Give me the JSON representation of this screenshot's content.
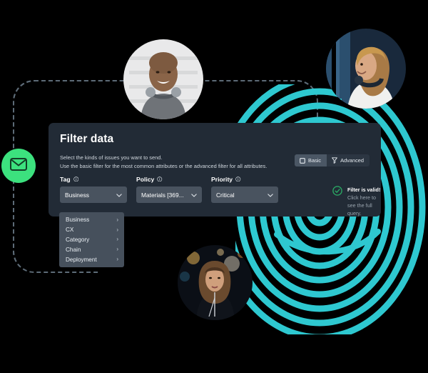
{
  "card": {
    "title": "Filter data",
    "description_line1": "Select the kinds of issues you want to send.",
    "description_line2": "Use the basic filter for the most common attributes or the advanced filter for all attributes.",
    "mode_toggle": [
      {
        "label": "Basic",
        "icon": "checkbox-square-icon",
        "active": true
      },
      {
        "label": "Advanced",
        "icon": "filter-funnel-icon",
        "active": false
      }
    ],
    "fields": [
      {
        "label": "Tag",
        "info_icon": "info-circle-icon",
        "value": "Business",
        "chevron": "chevron-down-icon"
      },
      {
        "label": "Policy",
        "info_icon": "info-circle-icon",
        "value": "Materials [369...",
        "chevron": "chevron-down-icon"
      },
      {
        "label": "Priority",
        "info_icon": "info-circle-icon",
        "value": "Critical",
        "chevron": "chevron-down-icon"
      }
    ],
    "validity": {
      "icon": "check-circle-icon",
      "strong_text": "Filter is valid!",
      "rest_text": " Click here to see the full query.",
      "accent_color": "#2aa763"
    }
  },
  "dropdown": {
    "items": [
      {
        "label": "Business",
        "chevron": "›"
      },
      {
        "label": "CX",
        "chevron": "›"
      },
      {
        "label": "Category",
        "chevron": "›"
      },
      {
        "label": "Chain",
        "chevron": "›"
      },
      {
        "label": "Deployment",
        "chevron": "›"
      }
    ]
  },
  "decorations": {
    "mail_badge": {
      "icon": "envelope-icon",
      "background": "#3ce17e",
      "glyph_color": "#123d26"
    },
    "fingerprint": {
      "name": "fingerprint-graphic",
      "color": "#2ec8d0"
    },
    "dashed_frame": {
      "name": "dashed-connector-frame",
      "color": "#5d6b77"
    },
    "avatars": [
      {
        "name": "avatar-man-headphones"
      },
      {
        "name": "avatar-woman-headphones-screen"
      },
      {
        "name": "avatar-woman-earphones-night"
      }
    ]
  }
}
